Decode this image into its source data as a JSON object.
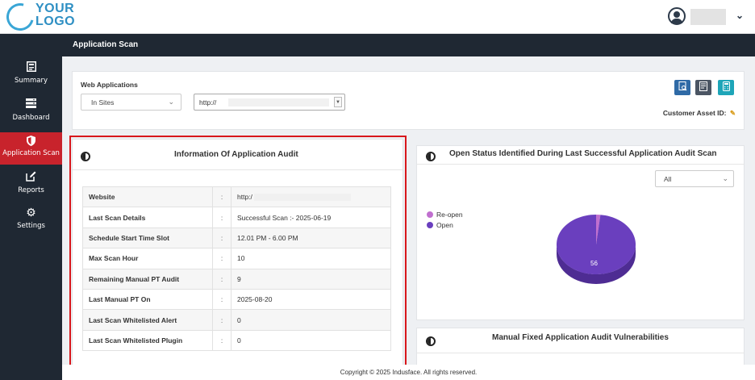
{
  "logo": {
    "line1": "YOUR",
    "line2": "LOGO"
  },
  "colors": {
    "sidebar": "#1f2833",
    "active": "#c8232c",
    "highlight": "#d8171c",
    "pie_open": "#6a3fbe",
    "pie_reopen": "#c06fcf"
  },
  "sidebar": {
    "items": [
      {
        "label": "Summary",
        "icon": "summary-icon"
      },
      {
        "label": "Dashboard",
        "icon": "dashboard-icon"
      },
      {
        "label": "Application Scan",
        "icon": "shield-icon",
        "active": true
      },
      {
        "label": "Reports",
        "icon": "edit-icon"
      },
      {
        "label": "Settings",
        "icon": "gear-icon"
      }
    ]
  },
  "header": {
    "title": "Application Scan"
  },
  "webapps": {
    "label": "Web Applications",
    "sites_value": "In Sites",
    "url_value": "http://",
    "customer_asset_label": "Customer Asset ID:"
  },
  "audit": {
    "title": "Information Of Application Audit",
    "rows": [
      {
        "key": "Website",
        "sep": ":",
        "value": "http:/"
      },
      {
        "key": "Last Scan Details",
        "sep": ":",
        "value": "Successful Scan :- 2025-06-19"
      },
      {
        "key": "Schedule Start Time Slot",
        "sep": ":",
        "value": "12.01 PM - 6.00 PM"
      },
      {
        "key": "Max Scan Hour",
        "sep": ":",
        "value": "10"
      },
      {
        "key": "Remaining Manual PT Audit",
        "sep": ":",
        "value": "9"
      },
      {
        "key": "Last Manual PT On",
        "sep": ":",
        "value": "2025-08-20"
      },
      {
        "key": "Last Scan Whitelisted Alert",
        "sep": ":",
        "value": "0"
      },
      {
        "key": "Last Scan Whitelisted Plugin",
        "sep": ":",
        "value": "0"
      }
    ]
  },
  "status": {
    "title": "Open Status Identified During Last Successful Application Audit Scan",
    "filter_value": "All",
    "legend": [
      {
        "name": "Re-open",
        "color": "#c06fcf"
      },
      {
        "name": "Open",
        "color": "#6a3fbe"
      }
    ],
    "pie_label": "56"
  },
  "chart_data": {
    "type": "pie",
    "categories": [
      "Re-open",
      "Open"
    ],
    "values": [
      1,
      56
    ]
  },
  "manual": {
    "title": "Manual Fixed Application Audit Vulnerabilities"
  },
  "footer": {
    "text": "Copyright © 2025 Indusface. All rights reserved."
  }
}
